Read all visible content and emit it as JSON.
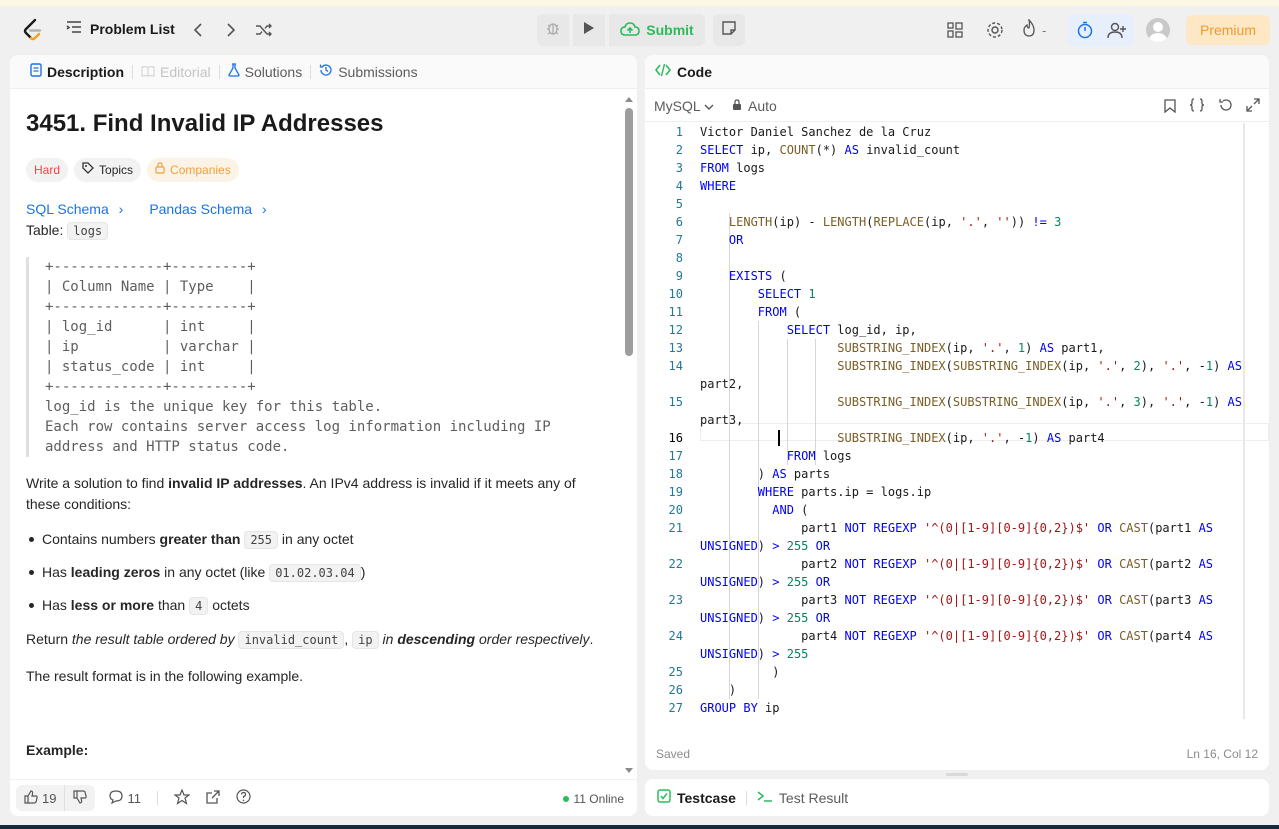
{
  "nav": {
    "problem_list": "Problem List",
    "submit": "Submit",
    "premium": "Premium",
    "streak": "-"
  },
  "left_tabs": [
    "Description",
    "Editorial",
    "Solutions",
    "Submissions"
  ],
  "problem": {
    "title": "3451. Find Invalid IP Addresses",
    "difficulty": "Hard",
    "topics": "Topics",
    "companies": "Companies",
    "sql_schema": "SQL Schema",
    "pandas_schema": "Pandas Schema",
    "table_label": "Table:",
    "table_name": "logs",
    "schema_lines": [
      "+-------------+---------+",
      "| Column Name | Type    |",
      "+-------------+---------+",
      "| log_id      | int     |",
      "| ip          | varchar |",
      "| status_code | int     |",
      "+-------------+---------+",
      "log_id is the unique key for this table.",
      "Each row contains server access log information including IP",
      "address and HTTP status code."
    ],
    "intro_1": "Write a solution to find ",
    "intro_bold": "invalid IP addresses",
    "intro_2": ". An IPv4 address is invalid if it meets any of these conditions:",
    "b1_pre": "Contains numbers ",
    "b1_bold": "greater than",
    "b1_code": "255",
    "b1_post": " in any octet",
    "b2_pre": "Has ",
    "b2_bold": "leading zeros",
    "b2_mid": " in any octet (like ",
    "b2_code": "01.02.03.04",
    "b2_post": ")",
    "b3_pre": "Has ",
    "b3_bold": "less or more",
    "b3_mid": " than ",
    "b3_code": "4",
    "b3_post": " octets",
    "ret_1": "Return ",
    "ret_it": "the result table ordered by ",
    "ret_code1": "invalid_count",
    "ret_code2": "ip",
    "ret_in": " in ",
    "ret_desc": "descending",
    "ret_end": " order respectively",
    "format": "The result format is in the following example.",
    "example": "Example:"
  },
  "footer": {
    "likes": "19",
    "comments": "11",
    "online": "11 Online"
  },
  "code_panel": {
    "title": "Code",
    "language": "MySQL",
    "mode": "Auto",
    "status_saved": "Saved",
    "cursor": "Ln 16, Col 12"
  },
  "bottom_tabs": [
    "Testcase",
    "Test Result"
  ]
}
